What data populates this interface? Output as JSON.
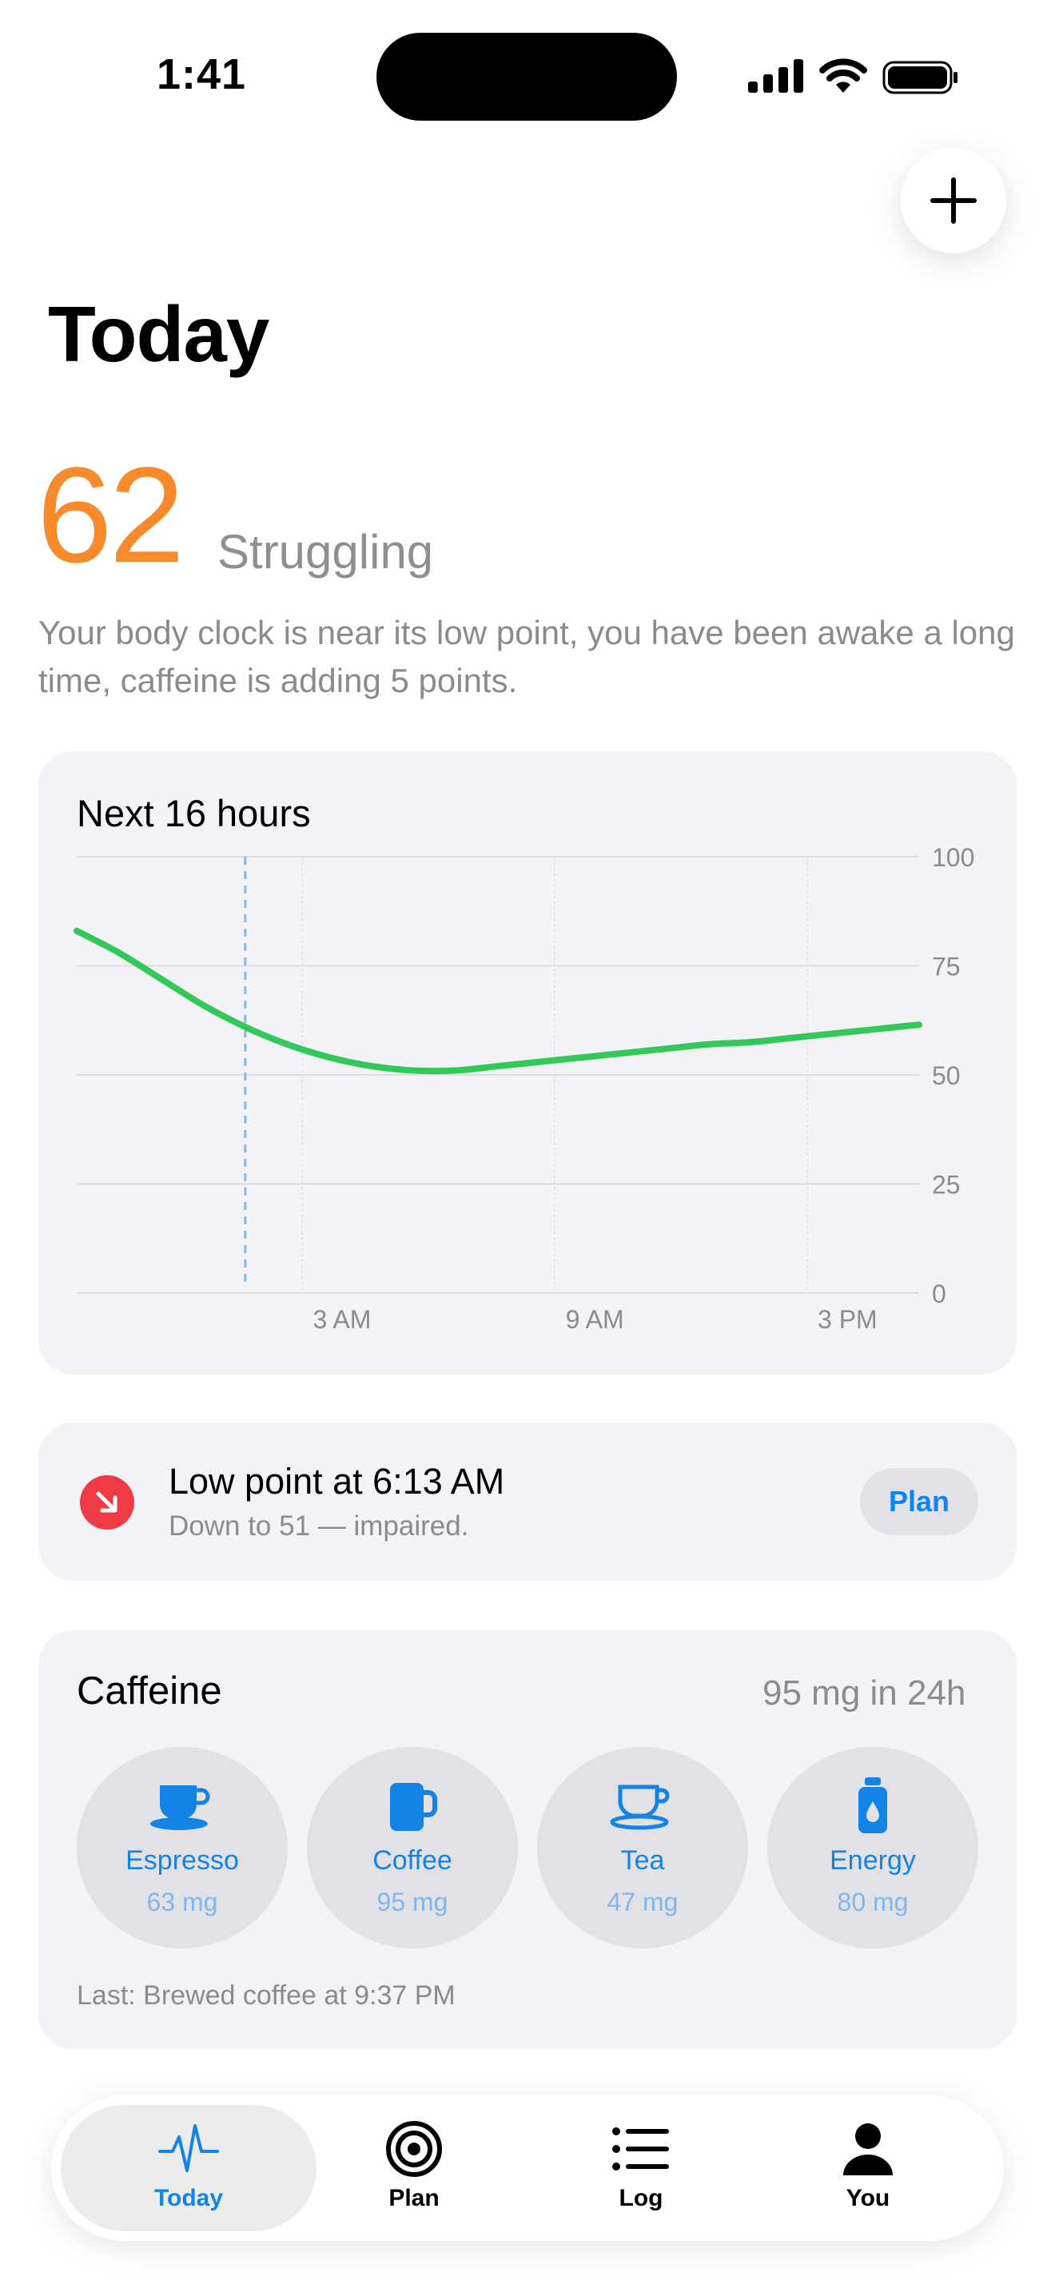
{
  "status_bar": {
    "time": "1:41"
  },
  "header": {
    "title": "Today"
  },
  "score": {
    "value": "62",
    "label": "Struggling"
  },
  "description": "Your body clock is near its low point, you have been awake a long time, caffeine is adding 5 points.",
  "chart_data": {
    "type": "line",
    "title": "Next 16 hours",
    "x_ticks": [
      "3 AM",
      "9 AM",
      "3 PM"
    ],
    "y_ticks": [
      "100",
      "75",
      "50",
      "25",
      "0"
    ],
    "ylim": [
      0,
      100
    ],
    "x_hours_from_start": [
      0,
      1,
      2,
      3,
      4,
      5,
      6,
      7,
      8,
      9,
      10,
      11,
      12,
      13,
      14,
      15,
      16,
      17,
      18,
      19,
      20
    ],
    "values": [
      83,
      78,
      72,
      66,
      61,
      57,
      54,
      52,
      51,
      51,
      52,
      53,
      54,
      55,
      56,
      57,
      57.5,
      58.5,
      59.5,
      60.5,
      61.5
    ],
    "now_marker_hour": 4,
    "color": "#34C759",
    "grid": true
  },
  "low_point": {
    "title": "Low point at 6:13 AM",
    "subtitle": "Down to 51 — impaired.",
    "button": "Plan"
  },
  "caffeine": {
    "title": "Caffeine",
    "total": "95 mg in 24h",
    "drinks": [
      {
        "name": "Espresso",
        "mg": "63 mg",
        "icon": "espresso-cup-icon"
      },
      {
        "name": "Coffee",
        "mg": "95 mg",
        "icon": "coffee-mug-icon"
      },
      {
        "name": "Tea",
        "mg": "47 mg",
        "icon": "tea-cup-icon"
      },
      {
        "name": "Energy",
        "mg": "80 mg",
        "icon": "energy-drink-icon"
      }
    ],
    "last": "Last: Brewed coffee at 9:37 PM"
  },
  "tabs": [
    {
      "label": "Today",
      "icon": "waveform-icon",
      "active": true
    },
    {
      "label": "Plan",
      "icon": "target-icon"
    },
    {
      "label": "Log",
      "icon": "list-icon"
    },
    {
      "label": "You",
      "icon": "person-icon"
    }
  ],
  "colors": {
    "accent": "#0A84FF",
    "score": "#F78A2B",
    "alert": "#EE3B45",
    "line": "#34C759"
  }
}
